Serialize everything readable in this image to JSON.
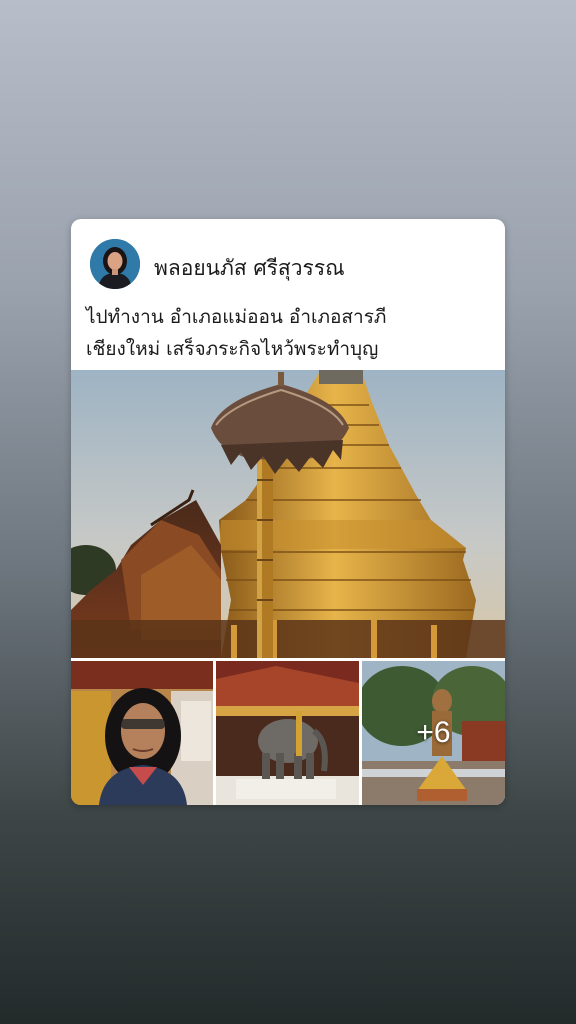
{
  "post": {
    "author_name": "พลอยนภัส ศรีสุวรรณ",
    "caption_line1": "ไปทำงาน อำเภอแม่ออน  อำเภอสารภี",
    "caption_line2": "เชียงใหม่  เสร็จภระกิจไหว้พระทำบุญ",
    "more_photos": "+6"
  },
  "colors": {
    "card_bg": "#ffffff",
    "text": "#1b1b1b",
    "gold": "#d4a233"
  }
}
